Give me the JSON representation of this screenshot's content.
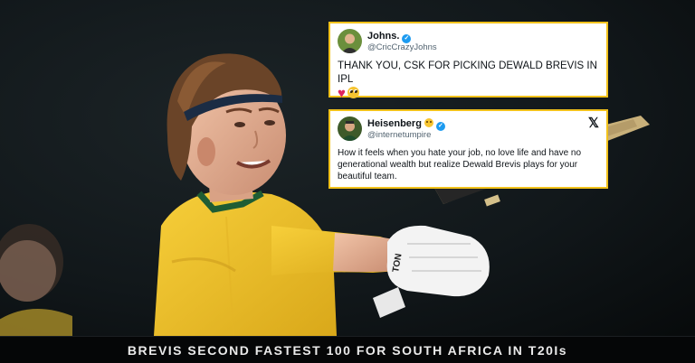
{
  "tweets": [
    {
      "name": "Johns.",
      "handle": "@CricCrazyJohns",
      "verified": true,
      "text": "THANK YOU, CSK FOR PICKING DEWALD BREVIS IN IPL",
      "emojis": [
        "red-heart",
        "pleading-face"
      ]
    },
    {
      "name": "Heisenberg",
      "handle": "@internetumpire",
      "verified": true,
      "text": "How it feels when you hate your job, no love life and have no generational wealth but realize Dewald Brevis plays for your beautiful team.",
      "brand_icon": "x-logo-icon"
    }
  ],
  "caption": "BREVIS SECOND FASTEST 100 FOR SOUTH AFRICA IN T20Is",
  "colors": {
    "tweet_border": "#f2c21b",
    "jersey": "#f2c02a",
    "background": "#0d1113",
    "verified": "#1d9bf0"
  }
}
